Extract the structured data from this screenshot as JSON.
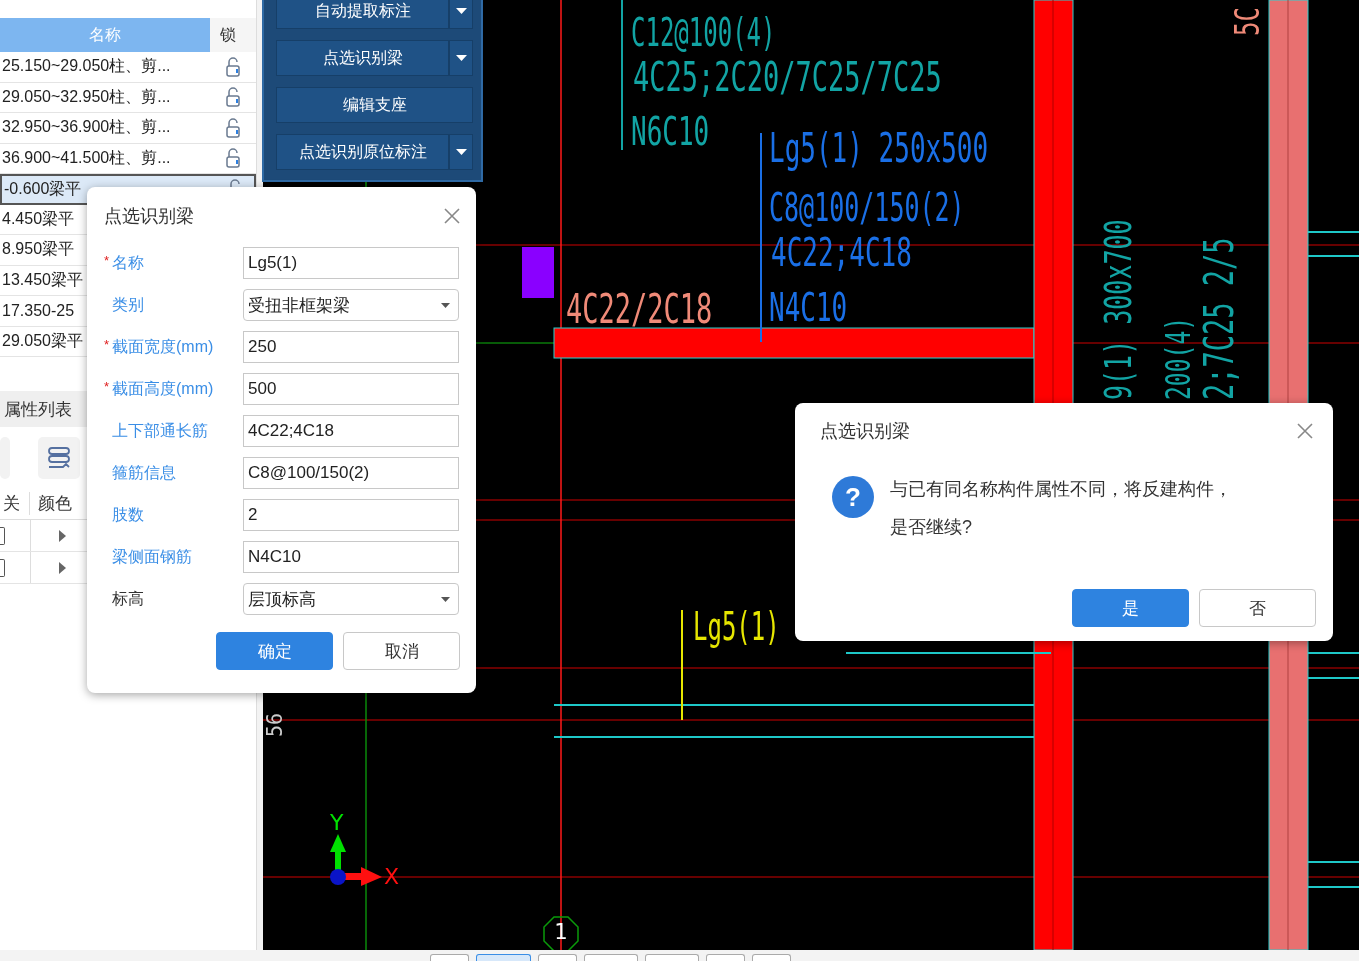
{
  "layer_table": {
    "columns": [
      "名称",
      "锁"
    ],
    "rows": [
      {
        "name": "25.150~29.050柱、剪...",
        "selected": false
      },
      {
        "name": "29.050~32.950柱、剪...",
        "selected": false
      },
      {
        "name": "32.950~36.900柱、剪...",
        "selected": false
      },
      {
        "name": "36.900~41.500柱、剪...",
        "selected": false
      },
      {
        "name": "-0.600梁平",
        "selected": true
      },
      {
        "name": "4.450梁平",
        "selected": false
      },
      {
        "name": "8.950梁平",
        "selected": false
      },
      {
        "name": "13.450梁平",
        "selected": false
      },
      {
        "name": "17.350-25",
        "selected": false
      },
      {
        "name": "29.050梁平",
        "selected": false
      }
    ]
  },
  "property_list": {
    "title": "属性列表",
    "columns": [
      "关",
      "颜色"
    ],
    "row_count_rows": [
      {
        "kind": "row",
        "checked": false
      },
      {
        "kind": "row",
        "checked": false
      }
    ]
  },
  "toolbar": {
    "buttons": [
      {
        "label": "自动提取标注",
        "dropdown": true
      },
      {
        "label": "点选识别梁",
        "dropdown": true
      },
      {
        "label": "编辑支座",
        "dropdown": false
      },
      {
        "label": "点选识别原位标注",
        "dropdown": true
      }
    ]
  },
  "cad": {
    "annotations": [
      {
        "text": "C12@100(4)",
        "color": "#12a4a4",
        "kind": "horizontal"
      },
      {
        "text": "4C25;2C20/7C25/7C25",
        "color": "#12a4a4",
        "kind": "horizontal"
      },
      {
        "text": "N6C10",
        "color": "#12a4a4",
        "kind": "horizontal"
      },
      {
        "text": "Lg5(1) 250x500",
        "color": "#1a6fe6",
        "kind": "horizontal"
      },
      {
        "text": "C8@100/150(2)",
        "color": "#1a6fe6",
        "kind": "horizontal"
      },
      {
        "text": "4C22;4C18",
        "color": "#1a6fe6",
        "kind": "horizontal"
      },
      {
        "text": "4C22/2C18",
        "color": "#f08a78",
        "kind": "horizontal"
      },
      {
        "text": "N4C10",
        "color": "#1a6fe6",
        "kind": "horizontal"
      },
      {
        "text": "Lg5(1)",
        "color": "#e6e600",
        "kind": "horizontal"
      },
      {
        "text": "9(1) 300x700",
        "color": "#12a4a4",
        "kind": "vertical"
      },
      {
        "text": "200(4)",
        "color": "#12a4a4",
        "kind": "vertical"
      },
      {
        "text": "2;7C25 2/5",
        "color": "#12a4a4",
        "kind": "vertical"
      },
      {
        "text": "5C",
        "color": "#f08a78",
        "kind": "vertical"
      },
      {
        "text": "56",
        "color": "#cccccc",
        "kind": "vertical"
      }
    ],
    "grid_axis": "1",
    "axis_x": "X",
    "axis_y": "Y"
  },
  "bottom_tabs": [
    {
      "selected": false
    },
    {
      "selected": true
    },
    {
      "selected": false
    },
    {
      "selected": false
    },
    {
      "selected": false
    },
    {
      "selected": false
    },
    {
      "selected": false
    }
  ],
  "beam_dialog": {
    "title": "点选识别梁",
    "fields": [
      {
        "label": "名称",
        "required_mark": "*",
        "color": "#3a8ee6",
        "kind": "text",
        "value": "Lg5(1)"
      },
      {
        "label": "类别",
        "color": "#3a8ee6",
        "kind": "dropdown",
        "value": "受扭非框架梁"
      },
      {
        "label": "截面宽度(mm)",
        "required_mark": "*",
        "color": "#3a8ee6",
        "kind": "text",
        "value": "250"
      },
      {
        "label": "截面高度(mm)",
        "required_mark": "*",
        "color": "#3a8ee6",
        "kind": "text",
        "value": "500"
      },
      {
        "label": "上下部通长筋",
        "color": "#3a8ee6",
        "kind": "text",
        "value": "4C22;4C18"
      },
      {
        "label": "箍筋信息",
        "color": "#3a8ee6",
        "kind": "text",
        "value": "C8@100/150(2)"
      },
      {
        "label": "肢数",
        "color": "#3a8ee6",
        "kind": "text",
        "value": "2"
      },
      {
        "label": "梁侧面钢筋",
        "color": "#3a8ee6",
        "kind": "text",
        "value": "N4C10"
      },
      {
        "label": "标高",
        "color": "#333333",
        "kind": "dropdown",
        "value": "层顶标高"
      }
    ],
    "buttons": [
      {
        "label": "确定",
        "primary": true
      },
      {
        "label": "取消",
        "primary": false
      }
    ]
  },
  "confirm_dialog": {
    "title": "点选识别梁",
    "icon": "?",
    "message": "与已有同名称构件属性不同，将反建构件，是否继续?",
    "buttons": [
      {
        "label": "是",
        "primary": true
      },
      {
        "label": "否",
        "primary": false
      }
    ]
  }
}
